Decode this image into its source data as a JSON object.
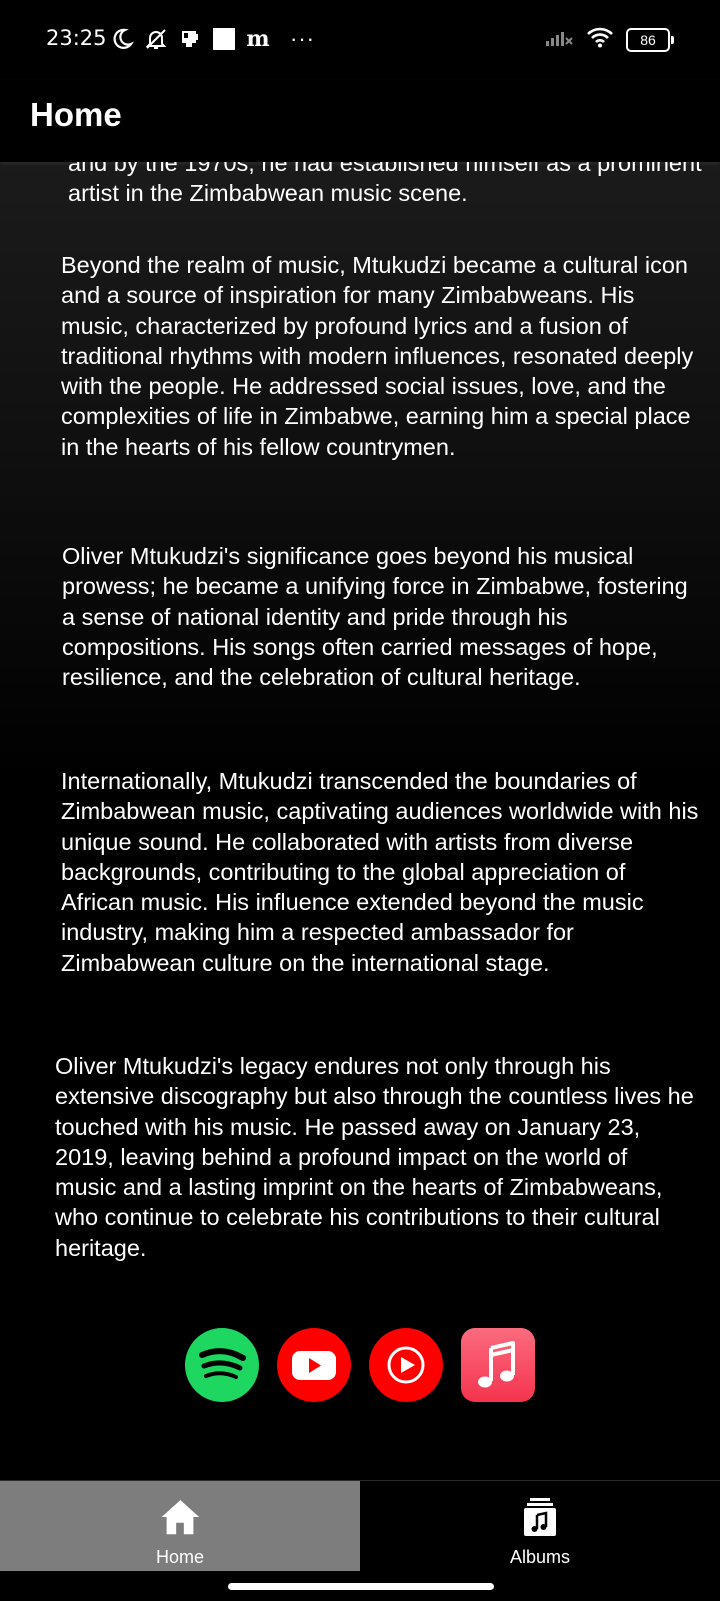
{
  "status_bar": {
    "time": "23:25",
    "battery": "86",
    "left_icons": [
      "moon-icon",
      "bell-off-icon",
      "sim-card-icon",
      "white-square-icon",
      "blackletter-m-icon",
      "more-dots-icon"
    ],
    "blackletter": "m",
    "dots": "···",
    "right_icons": [
      "signal-off-icon",
      "wifi-icon",
      "battery-icon"
    ]
  },
  "app_bar": {
    "title": "Home"
  },
  "article": {
    "paragraphs": [
      "and by the 1970s, he had established himself as a prominent artist in the Zimbabwean music scene.",
      "Beyond the realm of music, Mtukudzi became a cultural icon and a source of inspiration for many Zimbabweans. His music, characterized by profound lyrics and a fusion of traditional rhythms with modern influences, resonated deeply with the people. He addressed social issues, love, and the complexities of life in Zimbabwe, earning him a special place in the hearts of his fellow countrymen.",
      "Oliver Mtukudzi's significance goes beyond his musical prowess; he became a unifying force in Zimbabwe, fostering a sense of national identity and pride through his compositions. His songs often carried messages of hope, resilience, and the celebration of cultural heritage.",
      "Internationally, Mtukudzi transcended the boundaries of Zimbabwean music, captivating audiences worldwide with his unique sound. He collaborated with artists from diverse backgrounds, contributing to the global appreciation of African music. His influence extended beyond the music industry, making him a respected ambassador for Zimbabwean culture on the international stage.",
      "Oliver Mtukudzi's legacy endures not only through his extensive discography but also through the countless lives he touched with his music. He passed away on January 23, 2019, leaving behind a profound impact on the world of music and a lasting imprint on the hearts of Zimbabweans, who continue to celebrate his contributions to their cultural heritage."
    ]
  },
  "services": [
    {
      "icon": "spotify-icon",
      "color": "#1ed760"
    },
    {
      "icon": "youtube-icon",
      "color": "#ff0000"
    },
    {
      "icon": "youtube-music-icon",
      "color": "#ff0000"
    },
    {
      "icon": "apple-music-icon",
      "color": "#fa3e56"
    }
  ],
  "bottom_nav": {
    "items": [
      {
        "label": "Home",
        "icon": "home-icon",
        "active": true
      },
      {
        "label": "Albums",
        "icon": "albums-icon",
        "active": false
      }
    ],
    "active_bg": "#7d7d7d"
  }
}
